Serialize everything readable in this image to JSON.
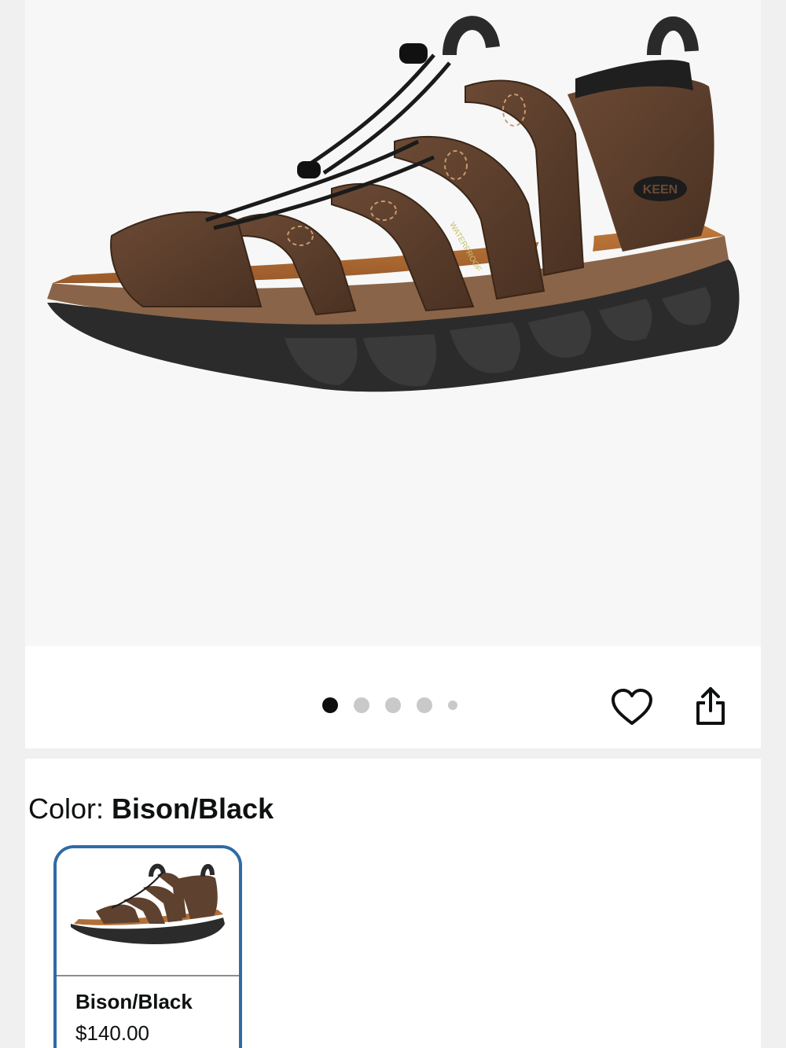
{
  "product_image": {
    "alt": "Bison/Black leather sandal",
    "brand_mark": "KEEN",
    "strap_text": "WATERPROOF"
  },
  "carousel": {
    "total": 5,
    "active_index": 0
  },
  "actions": {
    "wishlist_icon": "heart-icon",
    "share_icon": "share-icon"
  },
  "color_selector": {
    "label": "Color: ",
    "selected": "Bison/Black",
    "options": [
      {
        "name": "Bison/Black",
        "price": "$140.00",
        "selected": true
      }
    ]
  },
  "colors": {
    "selected_border": "#2f6ba5",
    "active_dot": "#0f0f0f",
    "inactive_dot": "#c9c9c9"
  }
}
